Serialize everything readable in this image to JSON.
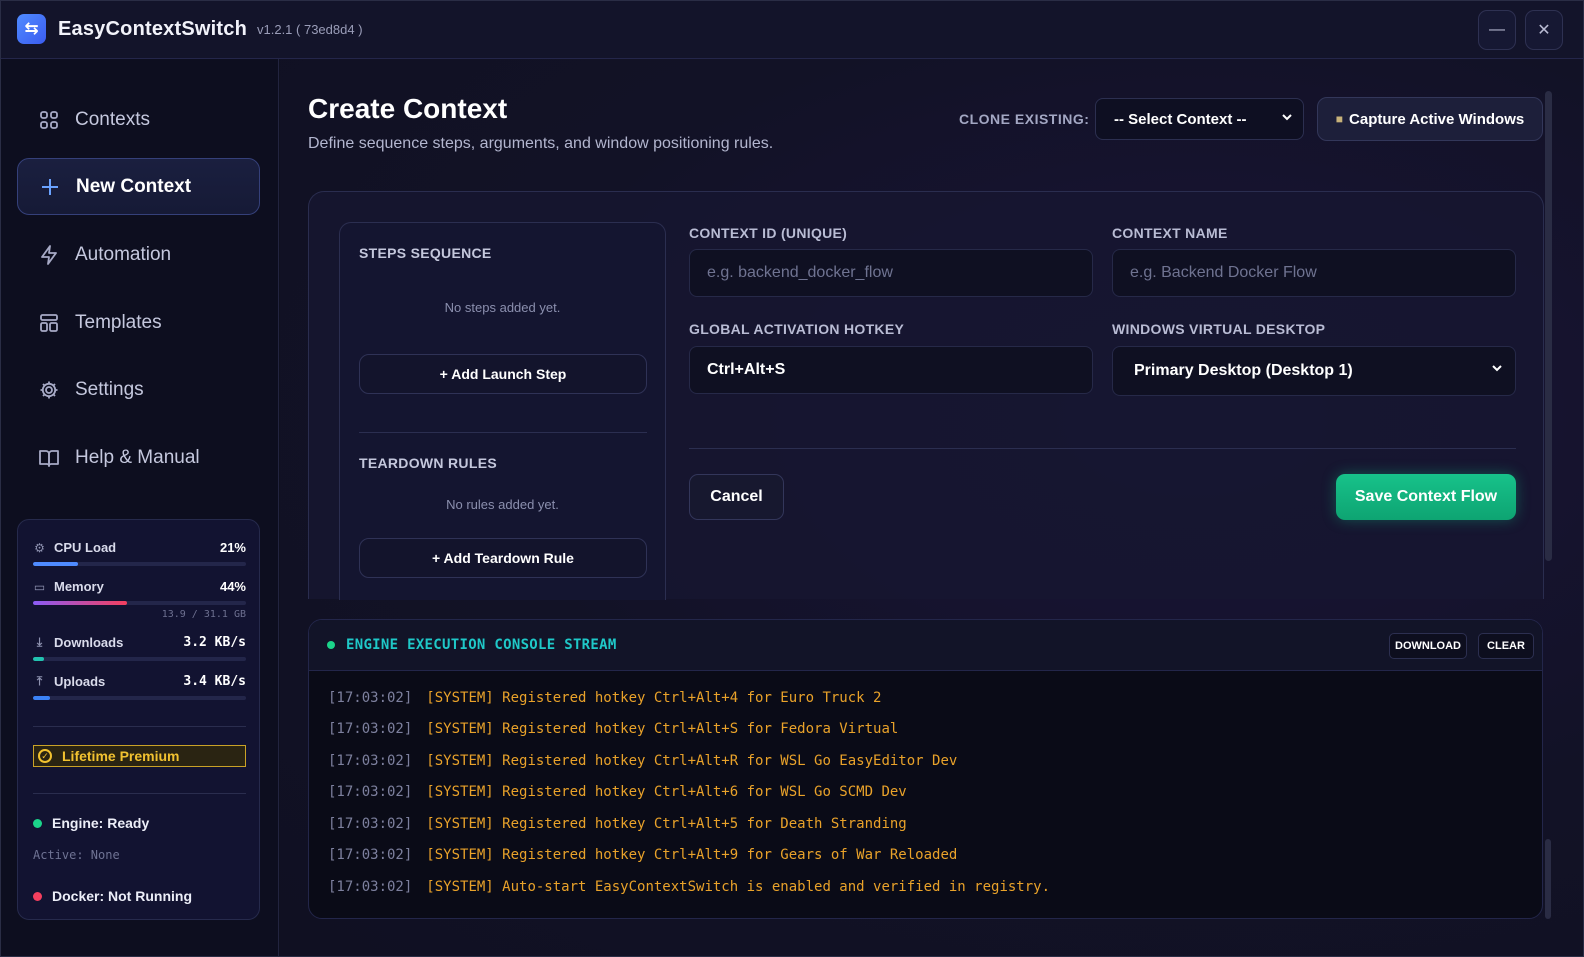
{
  "app": {
    "title": "EasyContextSwitch",
    "version": "v1.2.1 ( 73ed8d4 )",
    "logo_icon": "swap-arrows-icon"
  },
  "window_controls": {
    "minimize": "—",
    "close": "✕"
  },
  "sidebar": {
    "items": [
      {
        "label": "Contexts",
        "icon": "grid-icon",
        "active": false
      },
      {
        "label": "New Context",
        "icon": "plus-icon",
        "active": true
      },
      {
        "label": "Automation",
        "icon": "lightning-icon",
        "active": false
      },
      {
        "label": "Templates",
        "icon": "layout-icon",
        "active": false
      },
      {
        "label": "Settings",
        "icon": "gear-icon",
        "active": false
      },
      {
        "label": "Help & Manual",
        "icon": "book-icon",
        "active": false
      }
    ]
  },
  "stats": {
    "cpu": {
      "label": "CPU Load",
      "value": "21%",
      "fraction": 0.21,
      "color": "#4f8bff"
    },
    "memory": {
      "label": "Memory",
      "value": "44%",
      "fraction": 0.44,
      "detail": "13.9 / 31.1 GB",
      "color_start": "#8b5cf6",
      "color_end": "#f43f5e"
    },
    "downloads": {
      "label": "Downloads",
      "value": "3.2 KB/s",
      "fraction": 0.05,
      "color": "#22c3b0"
    },
    "uploads": {
      "label": "Uploads",
      "value": "3.4 KB/s",
      "fraction": 0.08,
      "color": "#3b82f6"
    },
    "premium": "Lifetime Premium",
    "engine_status": "Engine: Ready",
    "engine_color": "#1bd48a",
    "active": "Active: None",
    "docker_status": "Docker: Not Running",
    "docker_color": "#f43f5e"
  },
  "header": {
    "title": "Create Context",
    "subtitle": "Define sequence steps, arguments, and window positioning rules.",
    "clone_label": "CLONE EXISTING:",
    "clone_select_value": "-- Select Context --",
    "capture_button": "Capture Active Windows"
  },
  "steps": {
    "title": "STEPS SEQUENCE",
    "empty": "No steps added yet.",
    "add_button": "+ Add Launch Step"
  },
  "teardown": {
    "title": "TEARDOWN RULES",
    "empty": "No rules added yet.",
    "add_button": "+ Add Teardown Rule"
  },
  "form": {
    "context_id_label": "CONTEXT ID (UNIQUE)",
    "context_id_placeholder": "e.g. backend_docker_flow",
    "context_name_label": "CONTEXT NAME",
    "context_name_placeholder": "e.g. Backend Docker Flow",
    "hotkey_label": "GLOBAL ACTIVATION HOTKEY",
    "hotkey_value": "Ctrl+Alt+S",
    "desktop_label": "WINDOWS VIRTUAL DESKTOP",
    "desktop_value": "Primary Desktop (Desktop 1)",
    "cancel_button": "Cancel",
    "save_button": "Save Context Flow"
  },
  "console": {
    "title": "ENGINE EXECUTION CONSOLE STREAM",
    "download_button": "DOWNLOAD",
    "clear_button": "CLEAR",
    "lines": [
      {
        "ts": "[17:03:02]",
        "msg": "[SYSTEM] Registered hotkey Ctrl+Alt+4 for Euro Truck 2"
      },
      {
        "ts": "[17:03:02]",
        "msg": "[SYSTEM] Registered hotkey Ctrl+Alt+S for Fedora Virtual"
      },
      {
        "ts": "[17:03:02]",
        "msg": "[SYSTEM] Registered hotkey Ctrl+Alt+R for WSL Go EasyEditor Dev"
      },
      {
        "ts": "[17:03:02]",
        "msg": "[SYSTEM] Registered hotkey Ctrl+Alt+6 for WSL Go SCMD Dev"
      },
      {
        "ts": "[17:03:02]",
        "msg": "[SYSTEM] Registered hotkey Ctrl+Alt+5 for Death Stranding"
      },
      {
        "ts": "[17:03:02]",
        "msg": "[SYSTEM] Registered hotkey Ctrl+Alt+9 for Gears of War Reloaded"
      },
      {
        "ts": "[17:03:02]",
        "msg": "[SYSTEM] Auto-start EasyContextSwitch is enabled and verified in registry."
      }
    ]
  }
}
